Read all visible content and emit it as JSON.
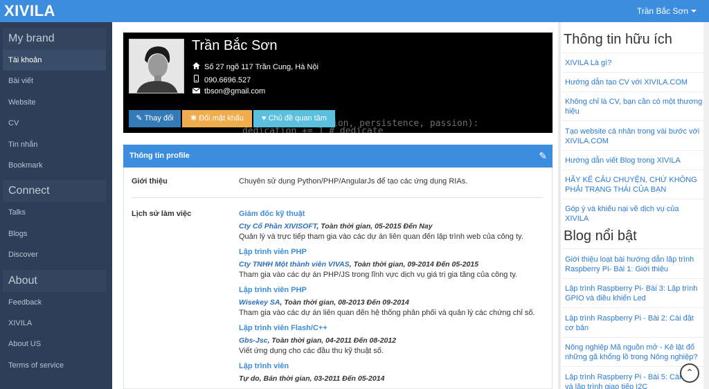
{
  "app": {
    "logo": "XIVILA",
    "user_name": "Trần Bắc Sơn"
  },
  "sidebar": {
    "sections": [
      {
        "title": "My brand",
        "items": [
          "Tài khoản",
          "Bài viết",
          "Website",
          "CV",
          "Tin nhắn",
          "Bookmark"
        ]
      },
      {
        "title": "Connect",
        "items": [
          "Talks",
          "Blogs",
          "Discover"
        ]
      },
      {
        "title": "About",
        "items": [
          "Feedback",
          "XIVILA",
          "About US",
          "Terms of service"
        ]
      }
    ],
    "active_item": "Tài khoản"
  },
  "hero": {
    "name": "Trần Bắc Sơn",
    "address": "Số 27 ngõ 117 Trần Cung, Hà Nội",
    "phone": "090.6696.527",
    "email": "tbson@gmail.com",
    "buttons": {
      "edit": "Thay đổi",
      "password": "Đổi mật khẩu",
      "favorites": "Chủ đề quan tâm"
    },
    "code_line1": "ion, persistence, passion):",
    "code_line2": "dedication += 1 # dedicate"
  },
  "profile": {
    "header": "Thông tin profile",
    "intro_label": "Giới thiệu",
    "intro_text": "Chuyên sử dụng Python/PHP/AngularJs để tạo các ứng dụng RIAs.",
    "history_label": "Lịch sử làm việc",
    "jobs": [
      {
        "title": "Giám đốc kỹ thuật",
        "company": "Cty Cổ Phần XIVISOFT",
        "meta": ", Toàn thời gian, 05-2015 Đến Nay",
        "desc": "Quản lý và trực tiếp tham gia vào các dự án liên quan đến lập trình web của công ty."
      },
      {
        "title": "Lập trình viên PHP",
        "company": "Cty TNHH Một thành viên VIVAS",
        "meta": ", Toàn thời gian, 09-2014 Đến 05-2015",
        "desc": "Tham gia vào các dự án PHP/JS trong lĩnh vực dịch vụ giá trị gia tăng của công ty."
      },
      {
        "title": "Lập trình viên PHP",
        "company": "Wisekey SA",
        "meta": ", Toàn thời gian, 08-2013 Đến 09-2014",
        "desc": "Tham gia vào các dự án liên quan đến hệ thống phân phối và quản lý các chứng chỉ số."
      },
      {
        "title": "Lập trình viên Flash/C++",
        "company": "Gbs-Jsc",
        "meta": ", Toàn thời gian, 04-2011 Đến 08-2012",
        "desc": "Viết ứng dụng cho các đầu thu kỹ thuật số."
      },
      {
        "title": "Lập trình viên",
        "company": "",
        "meta": "Tự do, Bán thời gian, 03-2011 Đến 05-2014",
        "desc": ""
      }
    ]
  },
  "right": {
    "useful_title": "Thông tin hữu ích",
    "useful_links": [
      "XIVILA Là gì?",
      "Hướng dẫn tạo CV với XIVILA.COM",
      "Không chỉ là CV, bạn cần có một thương hiệu",
      "Tạo website cá nhân trong vài bước với XIVILA.COM",
      "Hướng dẫn viết Blog trong XIVILA",
      "HÃY KỂ CÂU CHUYỆN, CHỨ KHÔNG PHẢI TRẠNG THÁI CỦA BẠN",
      "Góp ý và khiếu nại về dịch vụ của XIVILA"
    ],
    "blog_title": "Blog nổi bật",
    "blog_links": [
      "Giới thiệu loạt bài hướng dẫn lập trình Raspberry Pi- Bài 1: Giới thiệu",
      "Lập trình Raspberry Pi- Bài 3: Lập trình GPIO và điều khiển Led",
      "Lập trình Raspberry Pi - Bài 2: Cài đặt cơ bản",
      "Nông nghiệp Mã nguồn mở - Kẻ lật đổ những gã khổng lồ trong Nông nghiệp?",
      "Lập trình Raspberry Pi - Bài 5: Cài đặt và lập trình giao tiếp I2C"
    ]
  },
  "icons": {
    "home": "home-icon",
    "phone": "phone-icon",
    "email": "envelope-icon",
    "edit": "pencil-icon",
    "scroll_top": "scroll-top-icon"
  }
}
